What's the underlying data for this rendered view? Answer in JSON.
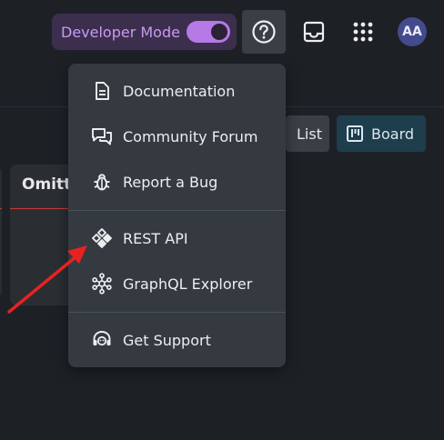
{
  "header": {
    "developer_mode_label": "Developer Mode",
    "developer_mode_on": true,
    "avatar_initials": "AA",
    "accent_color": "#b57ae6"
  },
  "view_switcher": {
    "list_label": "List",
    "board_label": "Board",
    "active": "Board"
  },
  "board": {
    "columns": [
      {
        "title": "Omitt"
      }
    ]
  },
  "help_menu": {
    "items": [
      {
        "label": "Documentation",
        "icon": "document-icon"
      },
      {
        "label": "Community Forum",
        "icon": "forum-icon"
      },
      {
        "label": "Report a Bug",
        "icon": "bug-icon"
      },
      {
        "label": "REST API",
        "icon": "api-icon"
      },
      {
        "label": "GraphQL Explorer",
        "icon": "graphql-icon"
      },
      {
        "label": "Get Support",
        "icon": "support-icon"
      }
    ]
  },
  "annotation": {
    "arrow_color": "#e8221e",
    "points_to": "REST API"
  }
}
